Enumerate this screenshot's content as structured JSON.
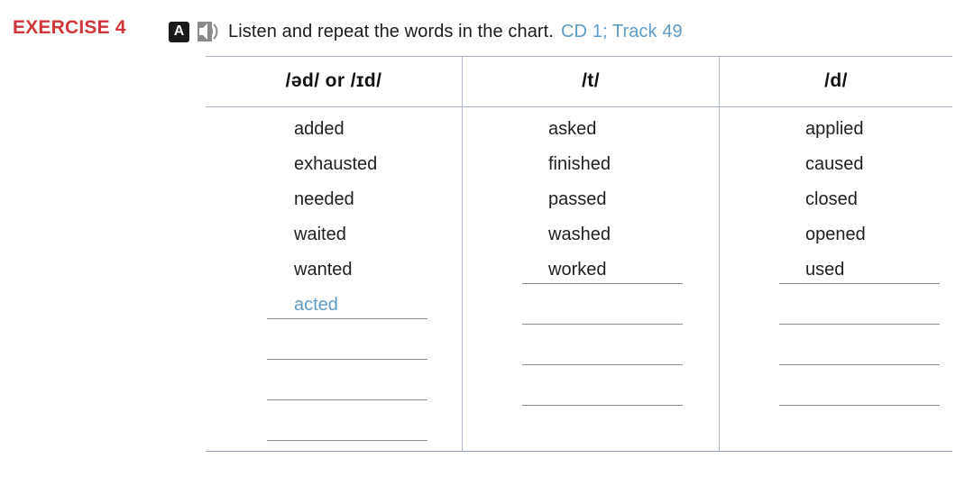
{
  "header": {
    "exercise_label": "EXERCISE 4",
    "part_badge": "A",
    "audio_icon": "speaker-icon",
    "instruction": "Listen and repeat the words in the chart.",
    "track_ref": "CD 1; Track 49",
    "exercise_color": "#d0363a",
    "track_color": "#5e9cc6"
  },
  "chart_data": {
    "type": "table",
    "title": "Listen and repeat the words in the chart.",
    "columns": [
      {
        "header": "/əd/ or /ɪd/",
        "words": [
          "added",
          "exhausted",
          "needed",
          "waited",
          "wanted"
        ],
        "filled_in": [
          "acted"
        ],
        "blank_lines": 4
      },
      {
        "header": "/t/",
        "words": [
          "asked",
          "finished",
          "passed",
          "washed",
          "worked"
        ],
        "filled_in": [],
        "blank_lines": 4
      },
      {
        "header": "/d/",
        "words": [
          "applied",
          "caused",
          "closed",
          "opened",
          "used"
        ],
        "filled_in": [],
        "blank_lines": 4
      }
    ],
    "filled_in_color": "#5e9cc6",
    "rule_color": "#aab0c4",
    "blank_line_color": "#8e8e92"
  }
}
